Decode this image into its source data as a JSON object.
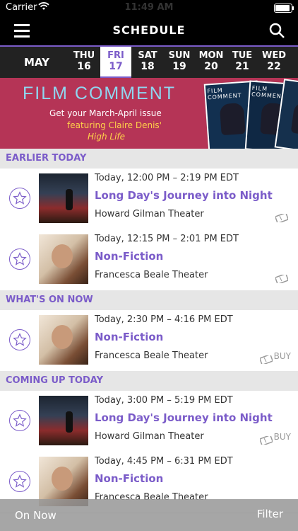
{
  "status": {
    "carrier": "Carrier",
    "time": "11:49 AM"
  },
  "nav": {
    "title": "SCHEDULE"
  },
  "dates": {
    "month": "MAY",
    "days": [
      {
        "dow": "THU",
        "num": "16"
      },
      {
        "dow": "FRI",
        "num": "17"
      },
      {
        "dow": "SAT",
        "num": "18"
      },
      {
        "dow": "SUN",
        "num": "19"
      },
      {
        "dow": "MON",
        "num": "20"
      },
      {
        "dow": "TUE",
        "num": "21"
      },
      {
        "dow": "WED",
        "num": "22"
      }
    ],
    "selected": "FRI"
  },
  "banner": {
    "brand": "FILM COMMENT",
    "line1": "Get your March-April issue",
    "line2": "featuring Claire Denis'",
    "line3": "High Life",
    "magazine_title": "FILM COMMENT"
  },
  "sections": [
    {
      "label": "EARLIER TODAY"
    },
    {
      "label": "WHAT'S ON NOW"
    },
    {
      "label": "COMING UP TODAY"
    }
  ],
  "screenings": [
    {
      "time": "Today, 12:00 PM – 2:19 PM EDT",
      "title": "Long Day's Journey into Night",
      "venue": "Howard Gilman Theater"
    },
    {
      "time": "Today, 12:15 PM – 2:01 PM EDT",
      "title": "Non-Fiction",
      "venue": "Francesca Beale Theater"
    },
    {
      "time": "Today, 2:30 PM – 4:16 PM EDT",
      "title": "Non-Fiction",
      "venue": "Francesca Beale Theater",
      "buy": "BUY"
    },
    {
      "time": "Today, 3:00 PM – 5:19 PM EDT",
      "title": "Long Day's Journey into Night",
      "venue": "Howard Gilman Theater",
      "buy": "BUY"
    },
    {
      "time": "Today, 4:45 PM – 6:31 PM EDT",
      "title": "Non-Fiction",
      "venue": "Francesca Beale Theater"
    }
  ],
  "bottom": {
    "on_now": "On Now",
    "filter": "Filter"
  },
  "colors": {
    "accent": "#7b5cc9",
    "banner": "#b53456",
    "header": "#000000"
  }
}
